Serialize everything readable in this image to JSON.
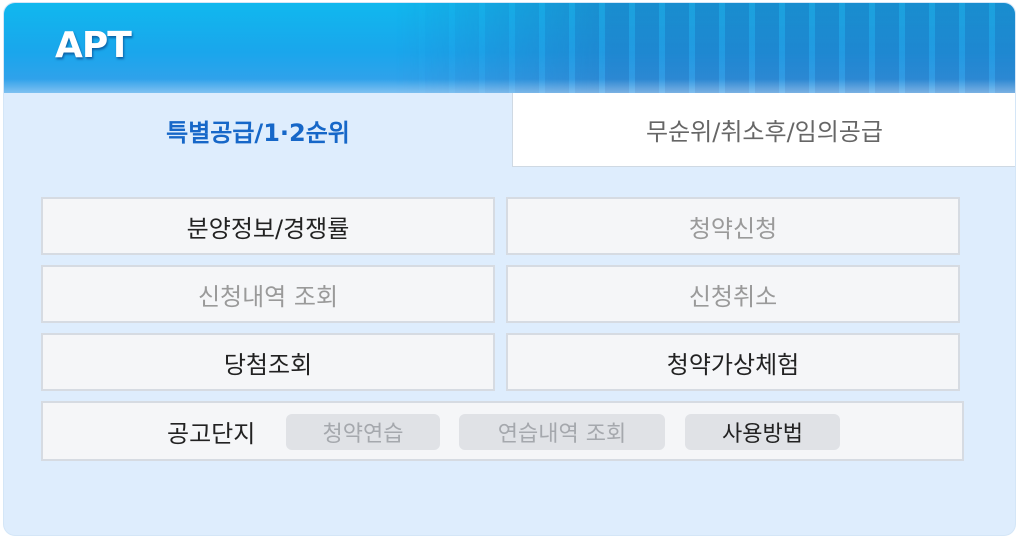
{
  "header": {
    "title": "APT"
  },
  "tabs": [
    {
      "label": "특별공급/1·2순위",
      "active": true
    },
    {
      "label": "무순위/취소후/임의공급",
      "active": false
    }
  ],
  "menu": {
    "supply_info": "분양정보/경쟁률",
    "apply": "청약신청",
    "history": "신청내역 조회",
    "cancel": "신청취소",
    "win_check": "당첨조회",
    "simulation": "청약가상체험"
  },
  "complex": {
    "label": "공고단지",
    "practice": "청약연습",
    "practice_history": "연습내역 조회",
    "how_to": "사용방법"
  },
  "colors": {
    "header_blue": "#10b8ee",
    "active_tab_text": "#1667c8",
    "panel_bg": "#deedfd",
    "disabled_text": "#9a9a9a"
  }
}
